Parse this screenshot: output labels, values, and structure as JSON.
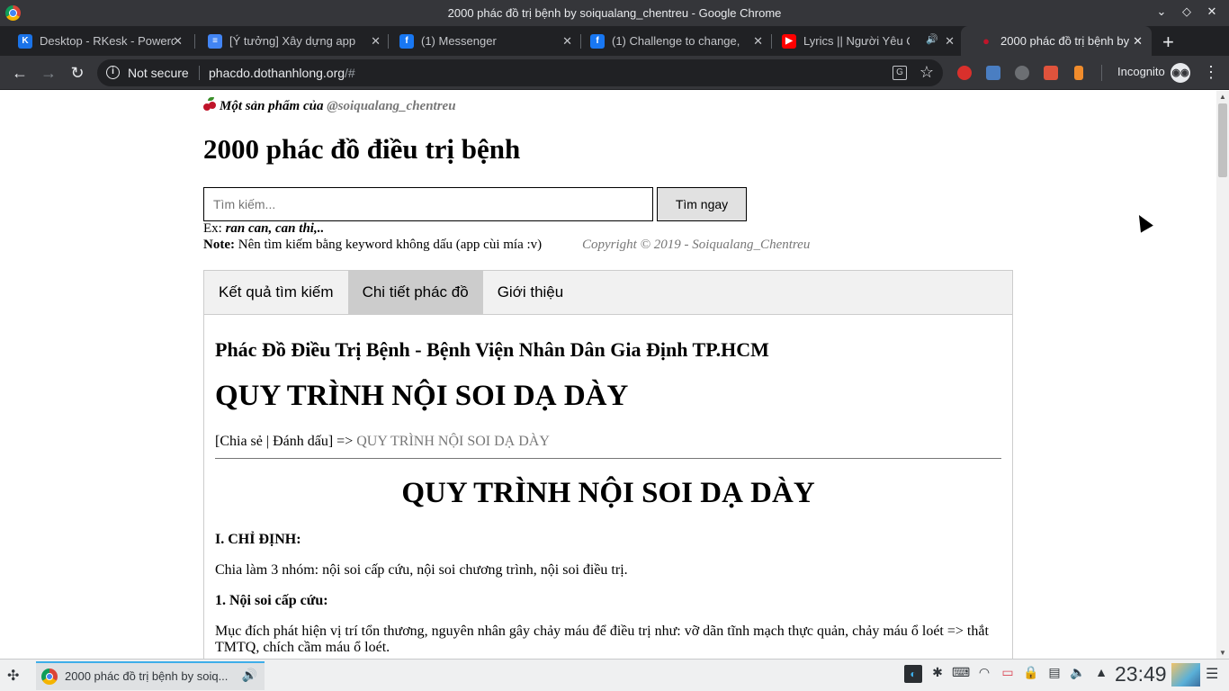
{
  "window": {
    "title": "2000 phác đồ trị bệnh by soiqualang_chentreu - Google Chrome",
    "controls": {
      "minimize": "⌄",
      "maximize": "◇",
      "close": "✕"
    }
  },
  "tabs": [
    {
      "label": "Desktop - RKesk - Powerd",
      "icon": "k-icon",
      "icon_color": "#1a73e8",
      "active": false
    },
    {
      "label": "[Ý tưởng] Xây dựng app",
      "icon": "docs-icon",
      "icon_color": "#4285f4",
      "active": false
    },
    {
      "label": "(1) Messenger",
      "icon": "facebook-icon",
      "icon_color": "#1877f2",
      "active": false
    },
    {
      "label": "(1) Challenge to change,",
      "icon": "facebook-icon",
      "icon_color": "#1877f2",
      "active": false
    },
    {
      "label": "Lyrics || Người Yêu C",
      "icon": "youtube-icon",
      "icon_color": "#ff0000",
      "active": false,
      "audio": "🔊"
    },
    {
      "label": "2000 phác đồ trị bệnh by",
      "icon": "cherry-icon",
      "icon_color": "#c0152a",
      "active": true
    }
  ],
  "toolbar": {
    "back": "←",
    "forward": "→",
    "reload": "↻",
    "security_label": "Not secure",
    "url_host": "phacdo.dothanhlong.org",
    "url_path": "/#",
    "incognito_label": "Incognito",
    "menu": "⋮"
  },
  "page": {
    "product_prefix": "Một sản phẩm của",
    "product_author": "@soiqualang_chentreu",
    "site_title": "2000 phác đồ điều trị bệnh",
    "search_placeholder": "Tìm kiếm...",
    "search_button": "Tìm ngay",
    "example_prefix": "Ex:",
    "example_text": "ran can, can thi,..",
    "note_label": "Note:",
    "note_text": "Nên tìm kiếm bằng keyword không dấu (app cùi mía :v)",
    "copyright": "Copyright © 2019 - Soiqualang_Chentreu",
    "tabs": [
      "Kết quả tìm kiếm",
      "Chi tiết phác đồ",
      "Giới thiệu"
    ],
    "selected_tab": "Chi tiết phác đồ",
    "hospital_title": "Phác Đồ Điều Trị Bệnh - Bệnh Viện Nhân Dân Gia Định TP.HCM",
    "doc_title": "QUY TRÌNH NỘI SOI DẠ DÀY",
    "breadcrumb_open": "[",
    "breadcrumb_share": "Chia sẻ",
    "breadcrumb_divider": " | ",
    "breadcrumb_bookmark": "Đánh dấu",
    "breadcrumb_close_arrow": "] =>",
    "breadcrumb_current": "QUY TRÌNH NỘI SOI DẠ DÀY",
    "doc_heading": "QUY TRÌNH NỘI SOI DẠ DÀY",
    "section_1": "I. CHỈ ĐỊNH:",
    "para_1": "Chia làm 3 nhóm: nội soi cấp cứu, nội soi chương trình, nội soi điều trị.",
    "subsection_1": "1. Nội soi cấp cứu:",
    "para_2": "Mục đích phát hiện vị trí tổn thương, nguyên nhân gây chảy máu để điều trị như: vỡ dãn tĩnh mạch thực quản, chảy máu ổ loét => thắt TMTQ, chích cầm máu ổ loét."
  },
  "taskbar": {
    "task_label": "2000 phác đồ trị bệnh by soiq...",
    "clock": "23:49"
  }
}
